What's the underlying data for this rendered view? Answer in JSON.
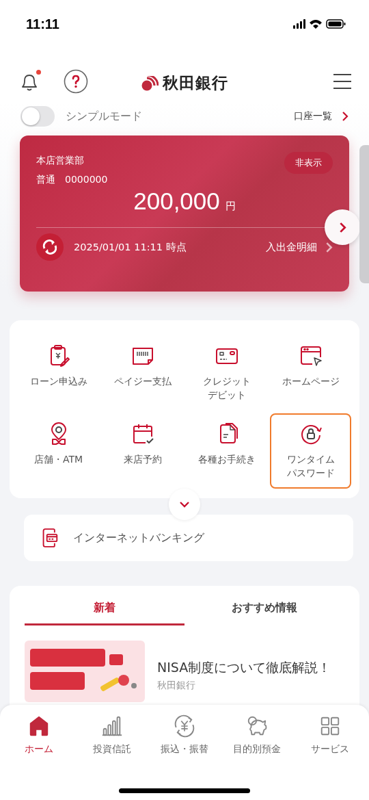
{
  "status_bar": {
    "time": "11:11"
  },
  "header": {
    "logo_text": "秋田銀行",
    "notification_dot": true
  },
  "simple_mode": {
    "label": "シンプルモード",
    "on": false
  },
  "account_list_link": "口座一覧",
  "account": {
    "branch": "本店営業部",
    "type": "普通",
    "number": "0000000",
    "amount": "200,000",
    "currency": "円",
    "hide_button": "非表示",
    "timestamp": "2025/01/01 11:11 時点",
    "statement_link": "入出金明細"
  },
  "menu": [
    {
      "label": [
        "ローン申込み"
      ],
      "kind": "loan",
      "highlighted": false
    },
    {
      "label": [
        "ペイジー支払"
      ],
      "kind": "payeasy",
      "highlighted": false
    },
    {
      "label": [
        "クレジット",
        "デビット"
      ],
      "kind": "card",
      "highlighted": false
    },
    {
      "label": [
        "ホームページ"
      ],
      "kind": "web",
      "highlighted": false
    },
    {
      "label": [
        "店舗・ATM"
      ],
      "kind": "map",
      "highlighted": false
    },
    {
      "label": [
        "来店予約"
      ],
      "kind": "calendar",
      "highlighted": false
    },
    {
      "label": [
        "各種お手続き"
      ],
      "kind": "document",
      "highlighted": false
    },
    {
      "label": [
        "ワンタイム",
        "パスワード"
      ],
      "kind": "lock",
      "highlighted": true
    }
  ],
  "internet_banking": {
    "label": "インターネットバンキング"
  },
  "news_tabs": [
    {
      "label": "新着",
      "selected": true
    },
    {
      "label": "おすすめ情報",
      "selected": false
    }
  ],
  "news": [
    {
      "kind": "picture",
      "title": "NISA制度について徹底解説！",
      "source": "秋田銀行"
    }
  ],
  "bottom_nav": [
    {
      "label": "ホーム",
      "kind": "home",
      "selected": true
    },
    {
      "label": "投資信託",
      "kind": "chart",
      "selected": false
    },
    {
      "label": "振込・振替",
      "kind": "transfer",
      "selected": false
    },
    {
      "label": "目的別預金",
      "kind": "piggy",
      "selected": false
    },
    {
      "label": "サービス",
      "kind": "grid",
      "selected": false
    }
  ]
}
